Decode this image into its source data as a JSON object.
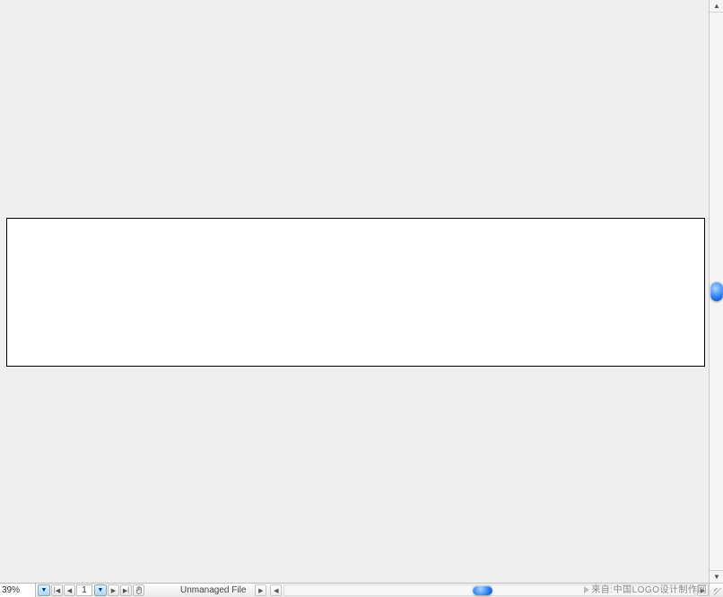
{
  "zoom": {
    "level": "39%"
  },
  "page_nav": {
    "current_page": "1"
  },
  "file_status": {
    "label": "Unmanaged File"
  },
  "attribution": {
    "text": "来自:中国LOGO设计制作网"
  },
  "icons": {
    "triangle_up": "▲",
    "triangle_down": "▼",
    "triangle_left": "◀",
    "triangle_right": "▶",
    "bar_left": "|",
    "bar_right": "|",
    "hand": "✋"
  }
}
